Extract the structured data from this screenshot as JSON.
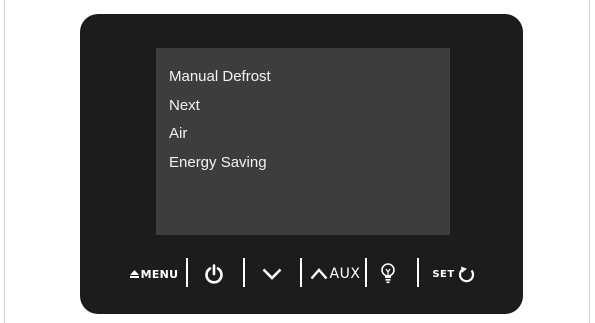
{
  "display": {
    "items": [
      {
        "label": "Manual Defrost"
      },
      {
        "label": "Next"
      },
      {
        "label": "Air"
      },
      {
        "label": "Energy Saving"
      }
    ]
  },
  "controls": {
    "menu_label": "MENU",
    "menu_icon": "eject-triangle-icon",
    "power_icon": "power-icon",
    "down_icon": "chevron-down-icon",
    "up_icon": "chevron-up-icon",
    "aux_label": "AUX",
    "light_icon": "light-bulb-icon",
    "set_label": "SET",
    "set_icon": "refresh-icon"
  },
  "colors": {
    "panel": "#1c1c1c",
    "screen": "#3d3d3d",
    "text": "#ffffff"
  }
}
